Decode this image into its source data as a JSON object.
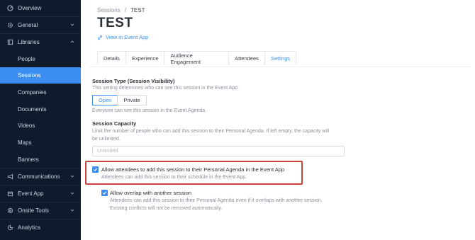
{
  "sidebar": {
    "items": [
      {
        "label": "Overview",
        "icon": "dashboard-icon"
      },
      {
        "label": "General",
        "icon": "gear-icon"
      },
      {
        "label": "Libraries",
        "icon": "book-icon"
      },
      {
        "label": "Communications",
        "icon": "megaphone-icon"
      },
      {
        "label": "Event App",
        "icon": "calendar-icon"
      },
      {
        "label": "Onsite Tools",
        "icon": "tool-icon"
      },
      {
        "label": "Analytics",
        "icon": "chart-icon"
      }
    ],
    "sub_items": [
      "People",
      "Sessions",
      "Companies",
      "Documents",
      "Videos",
      "Maps",
      "Banners"
    ],
    "active_sub": "Sessions"
  },
  "breadcrumb": {
    "parent": "Sessions",
    "separator": "/",
    "current": "TEST"
  },
  "page_title": "TEST",
  "view_link": "View in Event App",
  "tabs": [
    "Details",
    "Experience",
    "Audience Engagement",
    "Attendees",
    "Settings"
  ],
  "active_tab": "Settings",
  "session_type": {
    "label": "Session Type (Session Visibility)",
    "help": "This setting determines who can see this session in the Event App.",
    "options": [
      "Open",
      "Private"
    ],
    "selected": "Open",
    "note": "Everyone can see this session in the Event Agenda."
  },
  "capacity": {
    "label": "Session Capacity",
    "help_line1": "Limit the number of people who can add this session to their Personal Agenda. If left empty, the capacity will",
    "help_line2": "be unlimited.",
    "placeholder": "Unlimited"
  },
  "allow_add": {
    "label": "Allow attendees to add this session to their Personal Agenda in the Event App",
    "help": "Attendees can add this session to their schedule in the Event App.",
    "checked": true
  },
  "allow_overlap": {
    "label": "Allow overlap with another session",
    "help_line1": "Attendees can add this session to their Personal Agenda even if it overlaps with another session.",
    "help_line2": "Existing conflicts will not be removed automatically.",
    "checked": true
  },
  "colors": {
    "accent": "#3d8ef2",
    "sidebar_bg": "#0f1b2d",
    "highlight": "#c9433b"
  }
}
